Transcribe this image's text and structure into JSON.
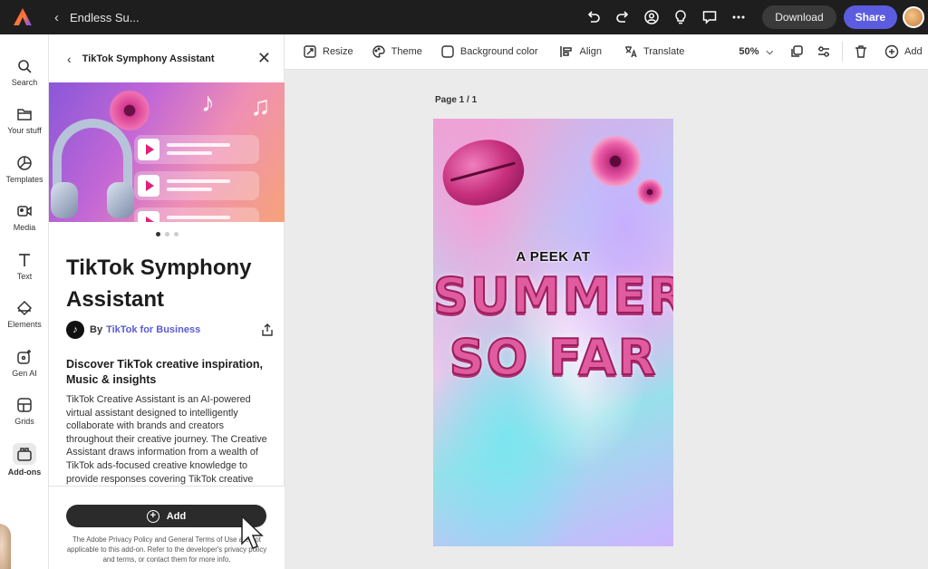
{
  "header": {
    "doc_title": "Endless Su...",
    "download_label": "Download",
    "share_label": "Share"
  },
  "rail": {
    "items": [
      {
        "label": "Search",
        "icon": "search-icon"
      },
      {
        "label": "Your stuff",
        "icon": "folder-icon"
      },
      {
        "label": "Templates",
        "icon": "templates-icon"
      },
      {
        "label": "Media",
        "icon": "media-icon"
      },
      {
        "label": "Text",
        "icon": "text-icon"
      },
      {
        "label": "Elements",
        "icon": "elements-icon"
      },
      {
        "label": "Gen AI",
        "icon": "gen-ai-icon"
      },
      {
        "label": "Grids",
        "icon": "grids-icon"
      },
      {
        "label": "Add-ons",
        "icon": "add-ons-icon",
        "active": true
      }
    ]
  },
  "panel": {
    "header_title": "TikTok Symphony Assistant",
    "addon_title": "TikTok Symphony Assistant",
    "by_label": "By",
    "publisher": "TikTok for Business",
    "desc_heading": "Discover TikTok creative inspiration, Music & insights",
    "desc_body": "TikTok Creative Assistant is an AI-powered virtual assistant designed to intelligently collaborate with brands and creators throughout their creative journey. The Creative Assistant draws information from a wealth of TikTok ads-focused creative knowledge to provide responses covering TikTok creative",
    "add_label": "Add",
    "legal_text": "The Adobe Privacy Policy and General Terms of Use are not applicable to this add-on. Refer to the developer's privacy policy and terms, or contact them for more info.",
    "carousel_pages": 3,
    "carousel_active": 1
  },
  "toolbar": {
    "resize": "Resize",
    "theme": "Theme",
    "background_color": "Background color",
    "align": "Align",
    "translate": "Translate",
    "zoom": "50%",
    "add": "Add"
  },
  "canvas": {
    "page_label": "Page 1 / 1",
    "line1": "A PEEK AT",
    "line2": "SUMMER",
    "line3": "SO FAR"
  },
  "colors": {
    "topbar_bg": "#1e1e1e",
    "share_accent": "#5c5ce0",
    "link_accent": "#5a5ad6"
  }
}
